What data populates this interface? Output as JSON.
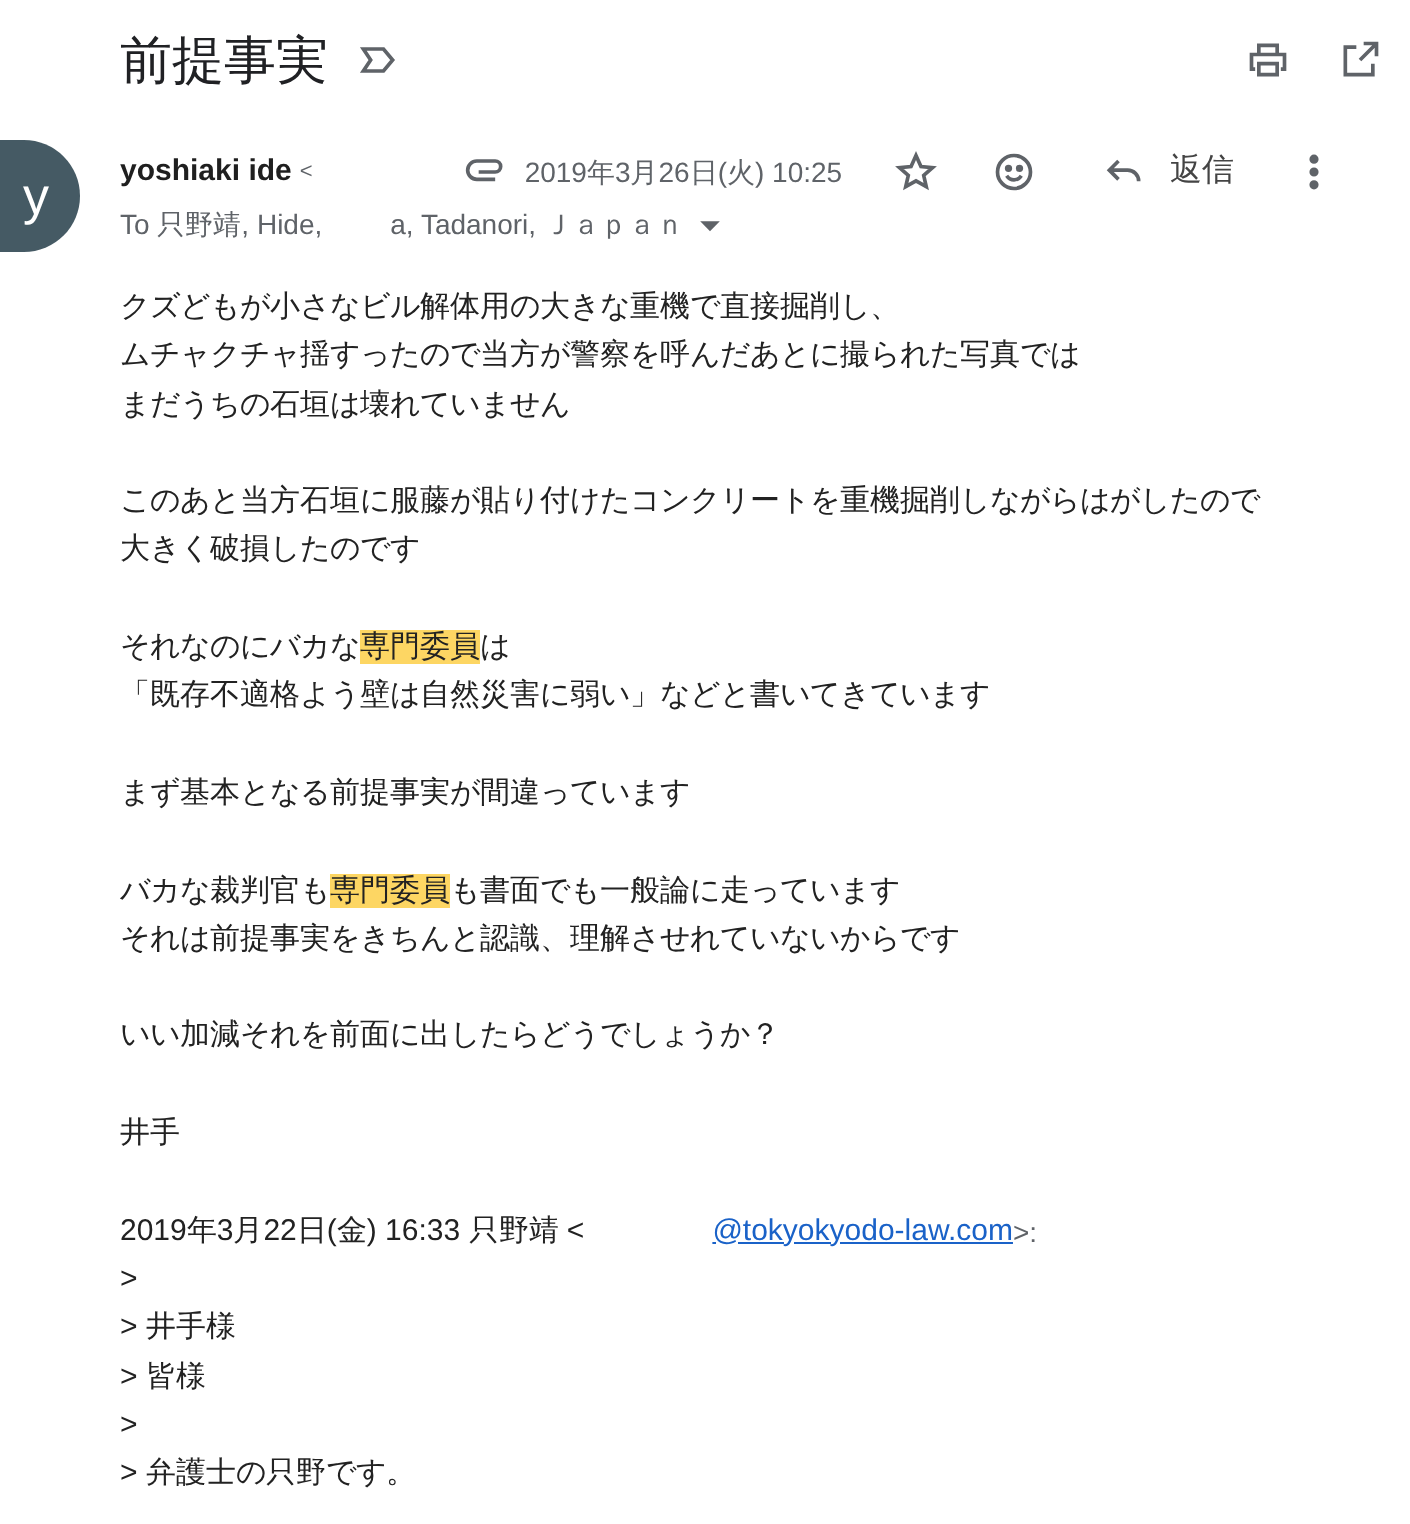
{
  "subject": "前提事実",
  "sender": {
    "name": "yoshiaki ide",
    "bracket": "<",
    "avatar_letter": "y",
    "date": "2019年3月26日(火) 10:25",
    "reply_label": "返信"
  },
  "recipients": {
    "prefix": "To 只野靖, Hide,",
    "rest": "a, Tadanori, Ｊａｐａｎ"
  },
  "body": [
    {
      "lines": [
        [
          {
            "text": "クズどもが小さなビル解体用の大きな重機で直接掘削し、",
            "highlighted": false
          }
        ],
        [
          {
            "text": "ムチャクチャ揺すったので当方が警察を呼んだあとに撮られた写真では",
            "highlighted": false
          }
        ],
        [
          {
            "text": "まだうちの石垣は壊れていません",
            "highlighted": false
          }
        ]
      ]
    },
    {
      "lines": [
        [
          {
            "text": "このあと当方石垣に服藤が貼り付けたコンクリートを重機掘削しながらはがしたので",
            "highlighted": false
          }
        ],
        [
          {
            "text": "大きく破損したのです",
            "highlighted": false
          }
        ]
      ]
    },
    {
      "lines": [
        [
          {
            "text": "それなのにバカな",
            "highlighted": false
          },
          {
            "text": "専門委員",
            "highlighted": true
          },
          {
            "text": "は",
            "highlighted": false
          }
        ],
        [
          {
            "text": "「既存不適格よう壁は自然災害に弱い」などと書いてきています",
            "highlighted": false
          }
        ]
      ]
    },
    {
      "lines": [
        [
          {
            "text": "まず基本となる前提事実が間違っています",
            "highlighted": false
          }
        ]
      ]
    },
    {
      "lines": [
        [
          {
            "text": "バカな裁判官も",
            "highlighted": false
          },
          {
            "text": "専門委員",
            "highlighted": true
          },
          {
            "text": "も書面でも一般論に走っています",
            "highlighted": false
          }
        ],
        [
          {
            "text": "それは前提事実をきちんと認識、理解させれていないからです",
            "highlighted": false
          }
        ]
      ]
    },
    {
      "lines": [
        [
          {
            "text": "いい加減それを前面に出したらどうでしょうか？",
            "highlighted": false
          }
        ]
      ]
    },
    {
      "lines": [
        [
          {
            "text": "井手",
            "highlighted": false
          }
        ]
      ]
    }
  ],
  "quote_header": {
    "text": "2019年3月22日(金) 16:33 只野靖 <",
    "link": "@tokyokyodo-law.com",
    "tail": ">:"
  },
  "quoted_lines": [
    ">",
    "> 井手様",
    "> 皆様",
    ">",
    "> 弁護士の只野です。"
  ]
}
